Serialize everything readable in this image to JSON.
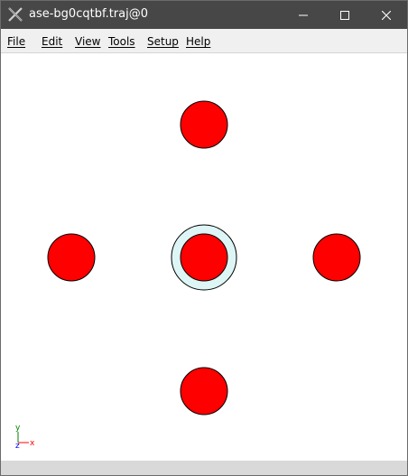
{
  "window": {
    "title": "ase-bg0cqtbf.traj@0",
    "icon": "ase-app-icon"
  },
  "window_controls": {
    "minimize_icon": "minimize-icon",
    "maximize_icon": "maximize-icon",
    "close_icon": "close-icon"
  },
  "menubar": {
    "items": [
      "File",
      "Edit",
      "View",
      "Tools",
      "Setup",
      "Help"
    ]
  },
  "canvas": {
    "background": "#ffffff",
    "atom_color": "#ff0000",
    "atom_outline": "#000000",
    "selection_color": "#ddf5f5",
    "atom_count": 5,
    "selected_atom_count": 1
  },
  "axes_indicator": {
    "x_label": "x",
    "y_label": "y",
    "z_label": "z",
    "x_color": "#ff0000",
    "y_color": "#008000",
    "z_color": "#0000ff"
  },
  "statusbar": {
    "text": ""
  }
}
